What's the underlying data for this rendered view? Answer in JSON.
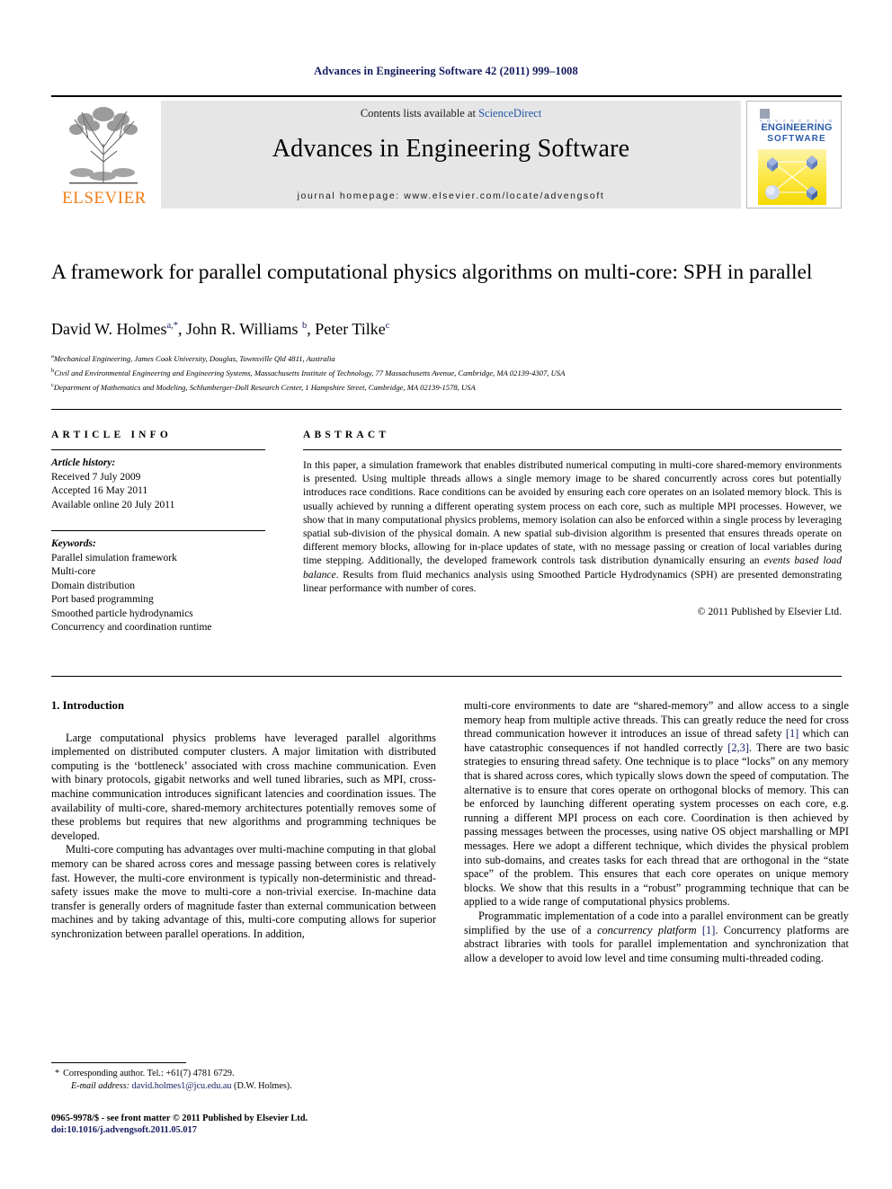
{
  "running_head": "Advances in Engineering Software 42 (2011) 999–1008",
  "masthead": {
    "publisher_name": "ELSEVIER",
    "contents_prefix": "Contents lists available at ",
    "contents_link": "ScienceDirect",
    "journal_name": "Advances in Engineering Software",
    "homepage": "journal homepage: www.elsevier.com/locate/advengsoft",
    "cover": {
      "line_small": "A D V A N C E S   I N",
      "line_main": "ENGINEERING",
      "line_sub": "SOFTWARE"
    }
  },
  "article": {
    "title": "A framework for parallel computational physics algorithms on multi-core: SPH in parallel",
    "authors": [
      {
        "name": "David W. Holmes",
        "marks": "a,*"
      },
      {
        "name": "John R. Williams",
        "marks": "b"
      },
      {
        "name": "Peter Tilke",
        "marks": "c"
      }
    ],
    "affiliations": [
      {
        "mark": "a",
        "text": "Mechanical Engineering, James Cook University, Douglas, Townsville Qld 4811, Australia"
      },
      {
        "mark": "b",
        "text": "Civil and Environmental Engineering and Engineering Systems, Massachusetts Institute of Technology, 77 Massachusetts Avenue, Cambridge, MA 02139-4307, USA"
      },
      {
        "mark": "c",
        "text": "Department of Mathematics and Modeling, Schlumberger-Doll Research Center, 1 Hampshire Street, Cambridge, MA 02139-1578, USA"
      }
    ]
  },
  "article_info": {
    "heading": "ARTICLE INFO",
    "history_label": "Article history:",
    "history": [
      "Received 7 July 2009",
      "Accepted 16 May 2011",
      "Available online 20 July 2011"
    ],
    "keywords_label": "Keywords:",
    "keywords": [
      "Parallel simulation framework",
      "Multi-core",
      "Domain distribution",
      "Port based programming",
      "Smoothed particle hydrodynamics",
      "Concurrency and coordination runtime"
    ]
  },
  "abstract": {
    "heading": "ABSTRACT",
    "part1": "In this paper, a simulation framework that enables distributed numerical computing in multi-core shared-memory environments is presented. Using multiple threads allows a single memory image to be shared concurrently across cores but potentially introduces race conditions. Race conditions can be avoided by ensuring each core operates on an isolated memory block. This is usually achieved by running a different operating system process on each core, such as multiple MPI processes. However, we show that in many computational physics problems, memory isolation can also be enforced within a single process by leveraging spatial sub-division of the physical domain. A new spatial sub-division algorithm is presented that ensures threads operate on different memory blocks, allowing for in-place updates of state, with no message passing or creation of local variables during time stepping. Additionally, the developed framework controls task distribution dynamically ensuring an ",
    "emphasis": "events based load balance",
    "part2": ". Results from fluid mechanics analysis using Smoothed Particle Hydrodynamics (SPH) are presented demonstrating linear performance with number of cores.",
    "copyright": "© 2011 Published by Elsevier Ltd."
  },
  "introduction": {
    "heading": "1. Introduction",
    "left_paragraphs": [
      "Large computational physics problems have leveraged parallel algorithms implemented on distributed computer clusters. A major limitation with distributed computing is the ‘bottleneck’ associated with cross machine communication. Even with binary protocols, gigabit networks and well tuned libraries, such as MPI, cross-machine communication introduces significant latencies and coordination issues. The availability of multi-core, shared-memory architectures potentially removes some of these problems but requires that new algorithms and programming techniques be developed.",
      "Multi-core computing has advantages over multi-machine computing in that global memory can be shared across cores and message passing between cores is relatively fast. However, the multi-core environment is typically non-deterministic and thread-safety issues make the move to multi-core a non-trivial exercise. In-machine data transfer is generally orders of magnitude faster than external communication between machines and by taking advantage of this, multi-core computing allows for superior synchronization between parallel operations. In addition,"
    ],
    "right_paragraph_1_a": "multi-core environments to date are “shared-memory” and allow access to a single memory heap from multiple active threads. This can greatly reduce the need for cross thread communication however it introduces an issue of thread safety ",
    "right_ref_1": "[1]",
    "right_paragraph_1_b": " which can have catastrophic consequences if not handled correctly ",
    "right_ref_2": "[2,3]",
    "right_paragraph_1_c": ". There are two basic strategies to ensuring thread safety. One technique is to place “locks” on any memory that is shared across cores, which typically slows down the speed of computation. The alternative is to ensure that cores operate on orthogonal blocks of memory. This can be enforced by launching different operating system processes on each core, e.g. running a different MPI process on each core. Coordination is then achieved by passing messages between the processes, using native OS object marshalling or MPI messages. Here we adopt a different technique, which divides the physical problem into sub-domains, and creates tasks for each thread that are orthogonal in the “state space” of the problem. This ensures that each core operates on unique memory blocks. We show that this results in a “robust” programming technique that can be applied to a wide range of computational physics problems.",
    "right_paragraph_2_a": "Programmatic implementation of a code into a parallel environment can be greatly simplified by the use of a ",
    "right_emphasis": "concurrency platform",
    "right_paragraph_2_b": " ",
    "right_ref_3": "[1]",
    "right_paragraph_2_c": ". Concurrency platforms are abstract libraries with tools for parallel implementation and synchronization that allow a developer to avoid low level and time consuming multi-threaded coding."
  },
  "footnotes": {
    "corresponding": "Corresponding author. Tel.: +61(7) 4781 6729.",
    "email_label": "E-mail address:",
    "email": "david.holmes1@jcu.edu.au",
    "email_suffix": "(D.W. Holmes)."
  },
  "imprint": {
    "line1": "0965-9978/$ - see front matter © 2011 Published by Elsevier Ltd.",
    "line2": "doi:10.1016/j.advengsoft.2011.05.017"
  },
  "colors": {
    "navy": "#13195e",
    "link_blue": "#2255a4",
    "elsevier_orange": "#ef7d1a",
    "band_gray": "#e6e6e6"
  }
}
